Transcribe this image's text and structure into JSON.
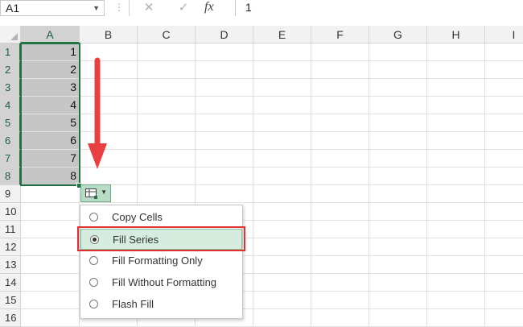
{
  "formula_bar": {
    "name_box": "A1",
    "cancel_symbol": "✕",
    "enter_symbol": "✓",
    "fx_label": "fx",
    "value": "1"
  },
  "columns": [
    "A",
    "B",
    "C",
    "D",
    "E",
    "F",
    "G",
    "H",
    "I"
  ],
  "rows": [
    "1",
    "2",
    "3",
    "4",
    "5",
    "6",
    "7",
    "8",
    "9",
    "10",
    "11",
    "12",
    "13",
    "14",
    "15",
    "16"
  ],
  "column_a_values": [
    "1",
    "2",
    "3",
    "4",
    "5",
    "6",
    "7",
    "8"
  ],
  "autofill_menu": {
    "items": [
      {
        "label": "Copy Cells",
        "selected": false
      },
      {
        "label": "Fill Series",
        "selected": true
      },
      {
        "label": "Fill Formatting Only",
        "selected": false
      },
      {
        "label": "Fill Without Formatting",
        "selected": false
      },
      {
        "label": "Flash Fill",
        "selected": false
      }
    ]
  },
  "colors": {
    "excel_green": "#217346",
    "selection_fill": "#c6c6c6",
    "highlight_red": "#e0302f",
    "arrow_red": "#e84040"
  }
}
